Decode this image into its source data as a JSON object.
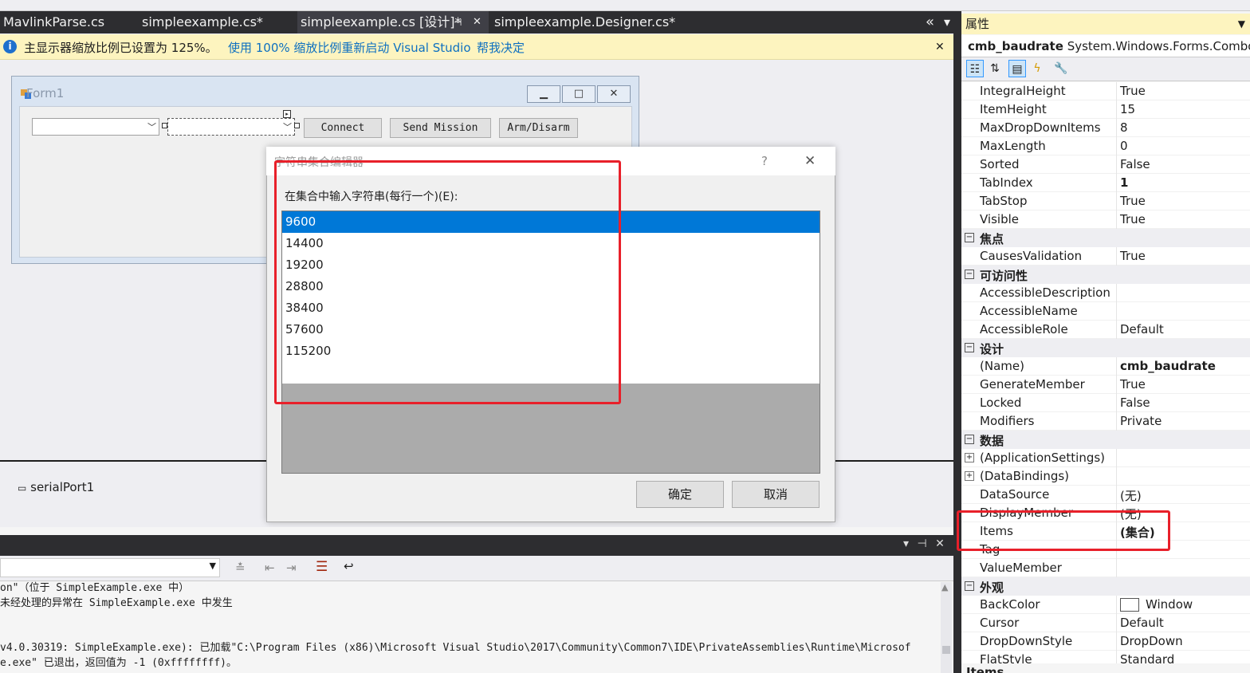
{
  "tabs": [
    {
      "label": "MavlinkParse.cs"
    },
    {
      "label": "simpleexample.cs*"
    },
    {
      "label": "simpleexample.cs [设计]*"
    },
    {
      "label": "simpleexample.Designer.cs*"
    }
  ],
  "tab_pin_glyph": "⊣",
  "tab_close_glyph": "✕",
  "tab_overflow_glyph": "«",
  "tab_dropdown_glyph": "▾",
  "infobar": {
    "message": "主显示器缩放比例已设置为 125%。",
    "link_restart": "使用 100% 缩放比例重新启动 Visual Studio",
    "link_help": "帮我决定",
    "close_glyph": "✕",
    "icon_glyph": "i"
  },
  "form1": {
    "title": "Form1",
    "connect_label": "Connect",
    "send_mission_label": "Send Mission",
    "arm_label": "Arm/Disarm"
  },
  "tray": {
    "serial_port": "serialPort1"
  },
  "dialog": {
    "title": "字符串集合编辑器",
    "help_glyph": "?",
    "close_glyph": "✕",
    "prompt": "在集合中输入字符串(每行一个)(E):",
    "items": [
      "9600",
      "14400",
      "19200",
      "28800",
      "38400",
      "57600",
      "115200"
    ],
    "selected_item": "9600",
    "ok_label": "确定",
    "cancel_label": "取消"
  },
  "output": {
    "head_controls": "▾ ⊣ ✕",
    "lines": [
      "on\"（位于 SimpleExample.exe 中）",
      "未经处理的异常在 SimpleExample.exe 中发生",
      "v4.0.30319: SimpleExample.exe): 已加载\"C:\\Program Files (x86)\\Microsoft Visual Studio\\2017\\Community\\Common7\\IDE\\PrivateAssemblies\\Runtime\\Microsof",
      "e.exe\" 已退出，返回值为 -1 (0xffffffff)。"
    ]
  },
  "properties": {
    "header": "属性",
    "object_name": "cmb_baudrate",
    "object_type": "System.Windows.Forms.ComboBox",
    "toolbar_icons": [
      "categorized-icon",
      "alphabetical-icon",
      "properties-icon",
      "events-icon",
      "property-pages-icon"
    ],
    "rows": [
      {
        "kind": "prop",
        "name": "IntegralHeight",
        "value": "True"
      },
      {
        "kind": "prop",
        "name": "ItemHeight",
        "value": "15"
      },
      {
        "kind": "prop",
        "name": "MaxDropDownItems",
        "value": "8"
      },
      {
        "kind": "prop",
        "name": "MaxLength",
        "value": "0"
      },
      {
        "kind": "prop",
        "name": "Sorted",
        "value": "False"
      },
      {
        "kind": "prop",
        "name": "TabIndex",
        "value": "1",
        "bold": true
      },
      {
        "kind": "prop",
        "name": "TabStop",
        "value": "True"
      },
      {
        "kind": "prop",
        "name": "Visible",
        "value": "True"
      },
      {
        "kind": "cat",
        "name": "焦点"
      },
      {
        "kind": "prop",
        "name": "CausesValidation",
        "value": "True"
      },
      {
        "kind": "cat",
        "name": "可访问性"
      },
      {
        "kind": "prop",
        "name": "AccessibleDescription",
        "value": ""
      },
      {
        "kind": "prop",
        "name": "AccessibleName",
        "value": ""
      },
      {
        "kind": "prop",
        "name": "AccessibleRole",
        "value": "Default"
      },
      {
        "kind": "cat",
        "name": "设计"
      },
      {
        "kind": "prop",
        "name": "(Name)",
        "value": "cmb_baudrate",
        "bold": true
      },
      {
        "kind": "prop",
        "name": "GenerateMember",
        "value": "True"
      },
      {
        "kind": "prop",
        "name": "Locked",
        "value": "False"
      },
      {
        "kind": "prop",
        "name": "Modifiers",
        "value": "Private"
      },
      {
        "kind": "cat",
        "name": "数据"
      },
      {
        "kind": "prop",
        "name": "(ApplicationSettings)",
        "value": "",
        "expand": true
      },
      {
        "kind": "prop",
        "name": "(DataBindings)",
        "value": "",
        "expand": true
      },
      {
        "kind": "prop",
        "name": "DataSource",
        "value": "(无)"
      },
      {
        "kind": "prop",
        "name": "DisplayMember",
        "value": "(无)"
      },
      {
        "kind": "prop",
        "name": "Items",
        "value": "(集合)",
        "bold": true
      },
      {
        "kind": "prop",
        "name": "Tag",
        "value": ""
      },
      {
        "kind": "prop",
        "name": "ValueMember",
        "value": ""
      },
      {
        "kind": "cat",
        "name": "外观"
      },
      {
        "kind": "prop",
        "name": "BackColor",
        "value": "Window",
        "swatch": "#ffffff"
      },
      {
        "kind": "prop",
        "name": "Cursor",
        "value": "Default"
      },
      {
        "kind": "prop",
        "name": "DropDownStyle",
        "value": "DropDown"
      },
      {
        "kind": "prop",
        "name": "FlatStyle",
        "value": "Standard"
      }
    ],
    "footer_label": "Items"
  },
  "colors": {
    "selection": "#0078d7",
    "highlight_box": "#e8202a",
    "infobar": "#fdf4bf",
    "tab_bar": "#2d2d30"
  }
}
